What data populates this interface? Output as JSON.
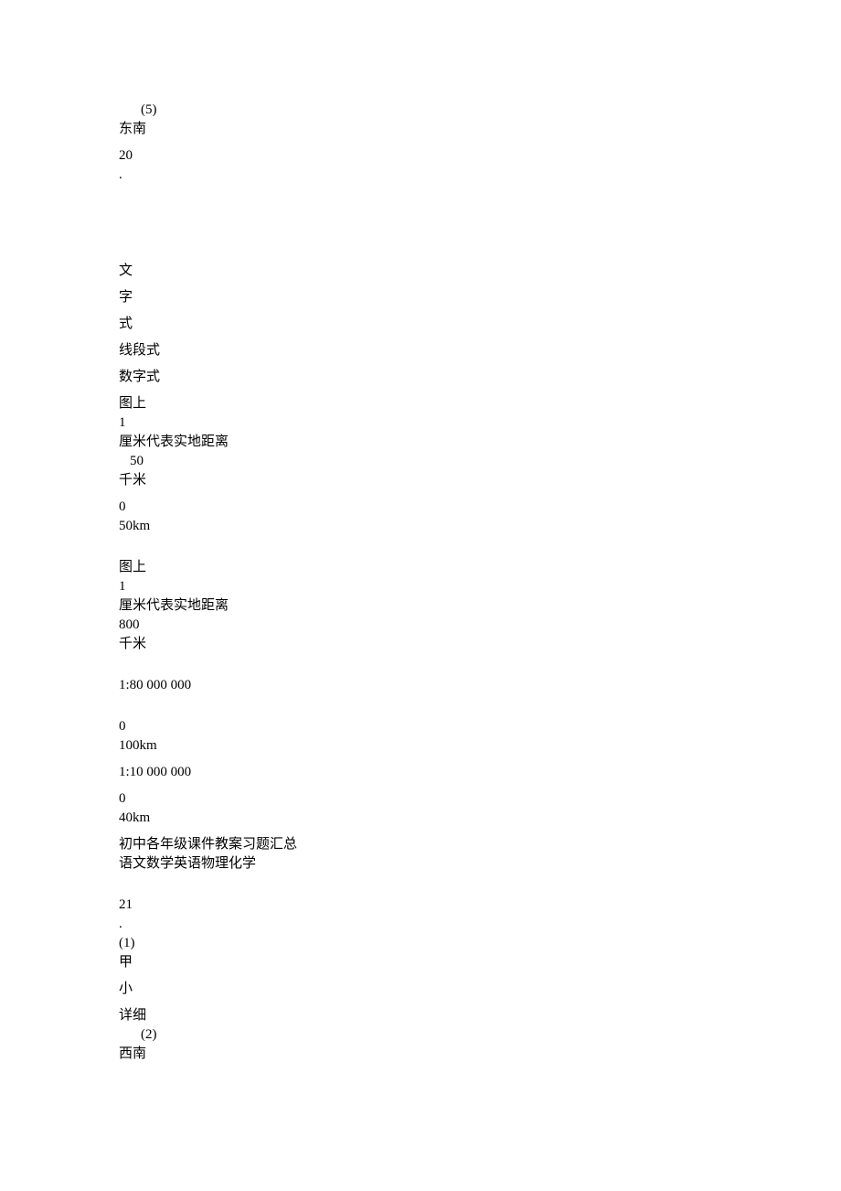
{
  "lines": {
    "l1": "(5)",
    "l2": "东南",
    "l3": "20",
    "l4": ".",
    "l5": "文",
    "l6": "字",
    "l7": "式",
    "l8": "线段式",
    "l9": "数字式",
    "l10": "图上",
    "l11": "1",
    "l12": "厘米代表实地距离",
    "l13": "50",
    "l14": "千米",
    "l15": "0",
    "l16": "50km",
    "l17": "图上",
    "l18": "1",
    "l19": "厘米代表实地距离",
    "l20": "800",
    "l21": "千米",
    "l22": "1:80 000 000",
    "l23": "0",
    "l24": "100km",
    "l25": "1:10 000 000",
    "l26": "0",
    "l27": "40km",
    "l28": "初中各年级课件教案习题汇总",
    "l29": "语文数学英语物理化学",
    "l30": "21",
    "l31": ".",
    "l32": "(1)",
    "l33": "甲",
    "l34": "小",
    "l35": "详细",
    "l36": "(2)",
    "l37": "西南"
  }
}
